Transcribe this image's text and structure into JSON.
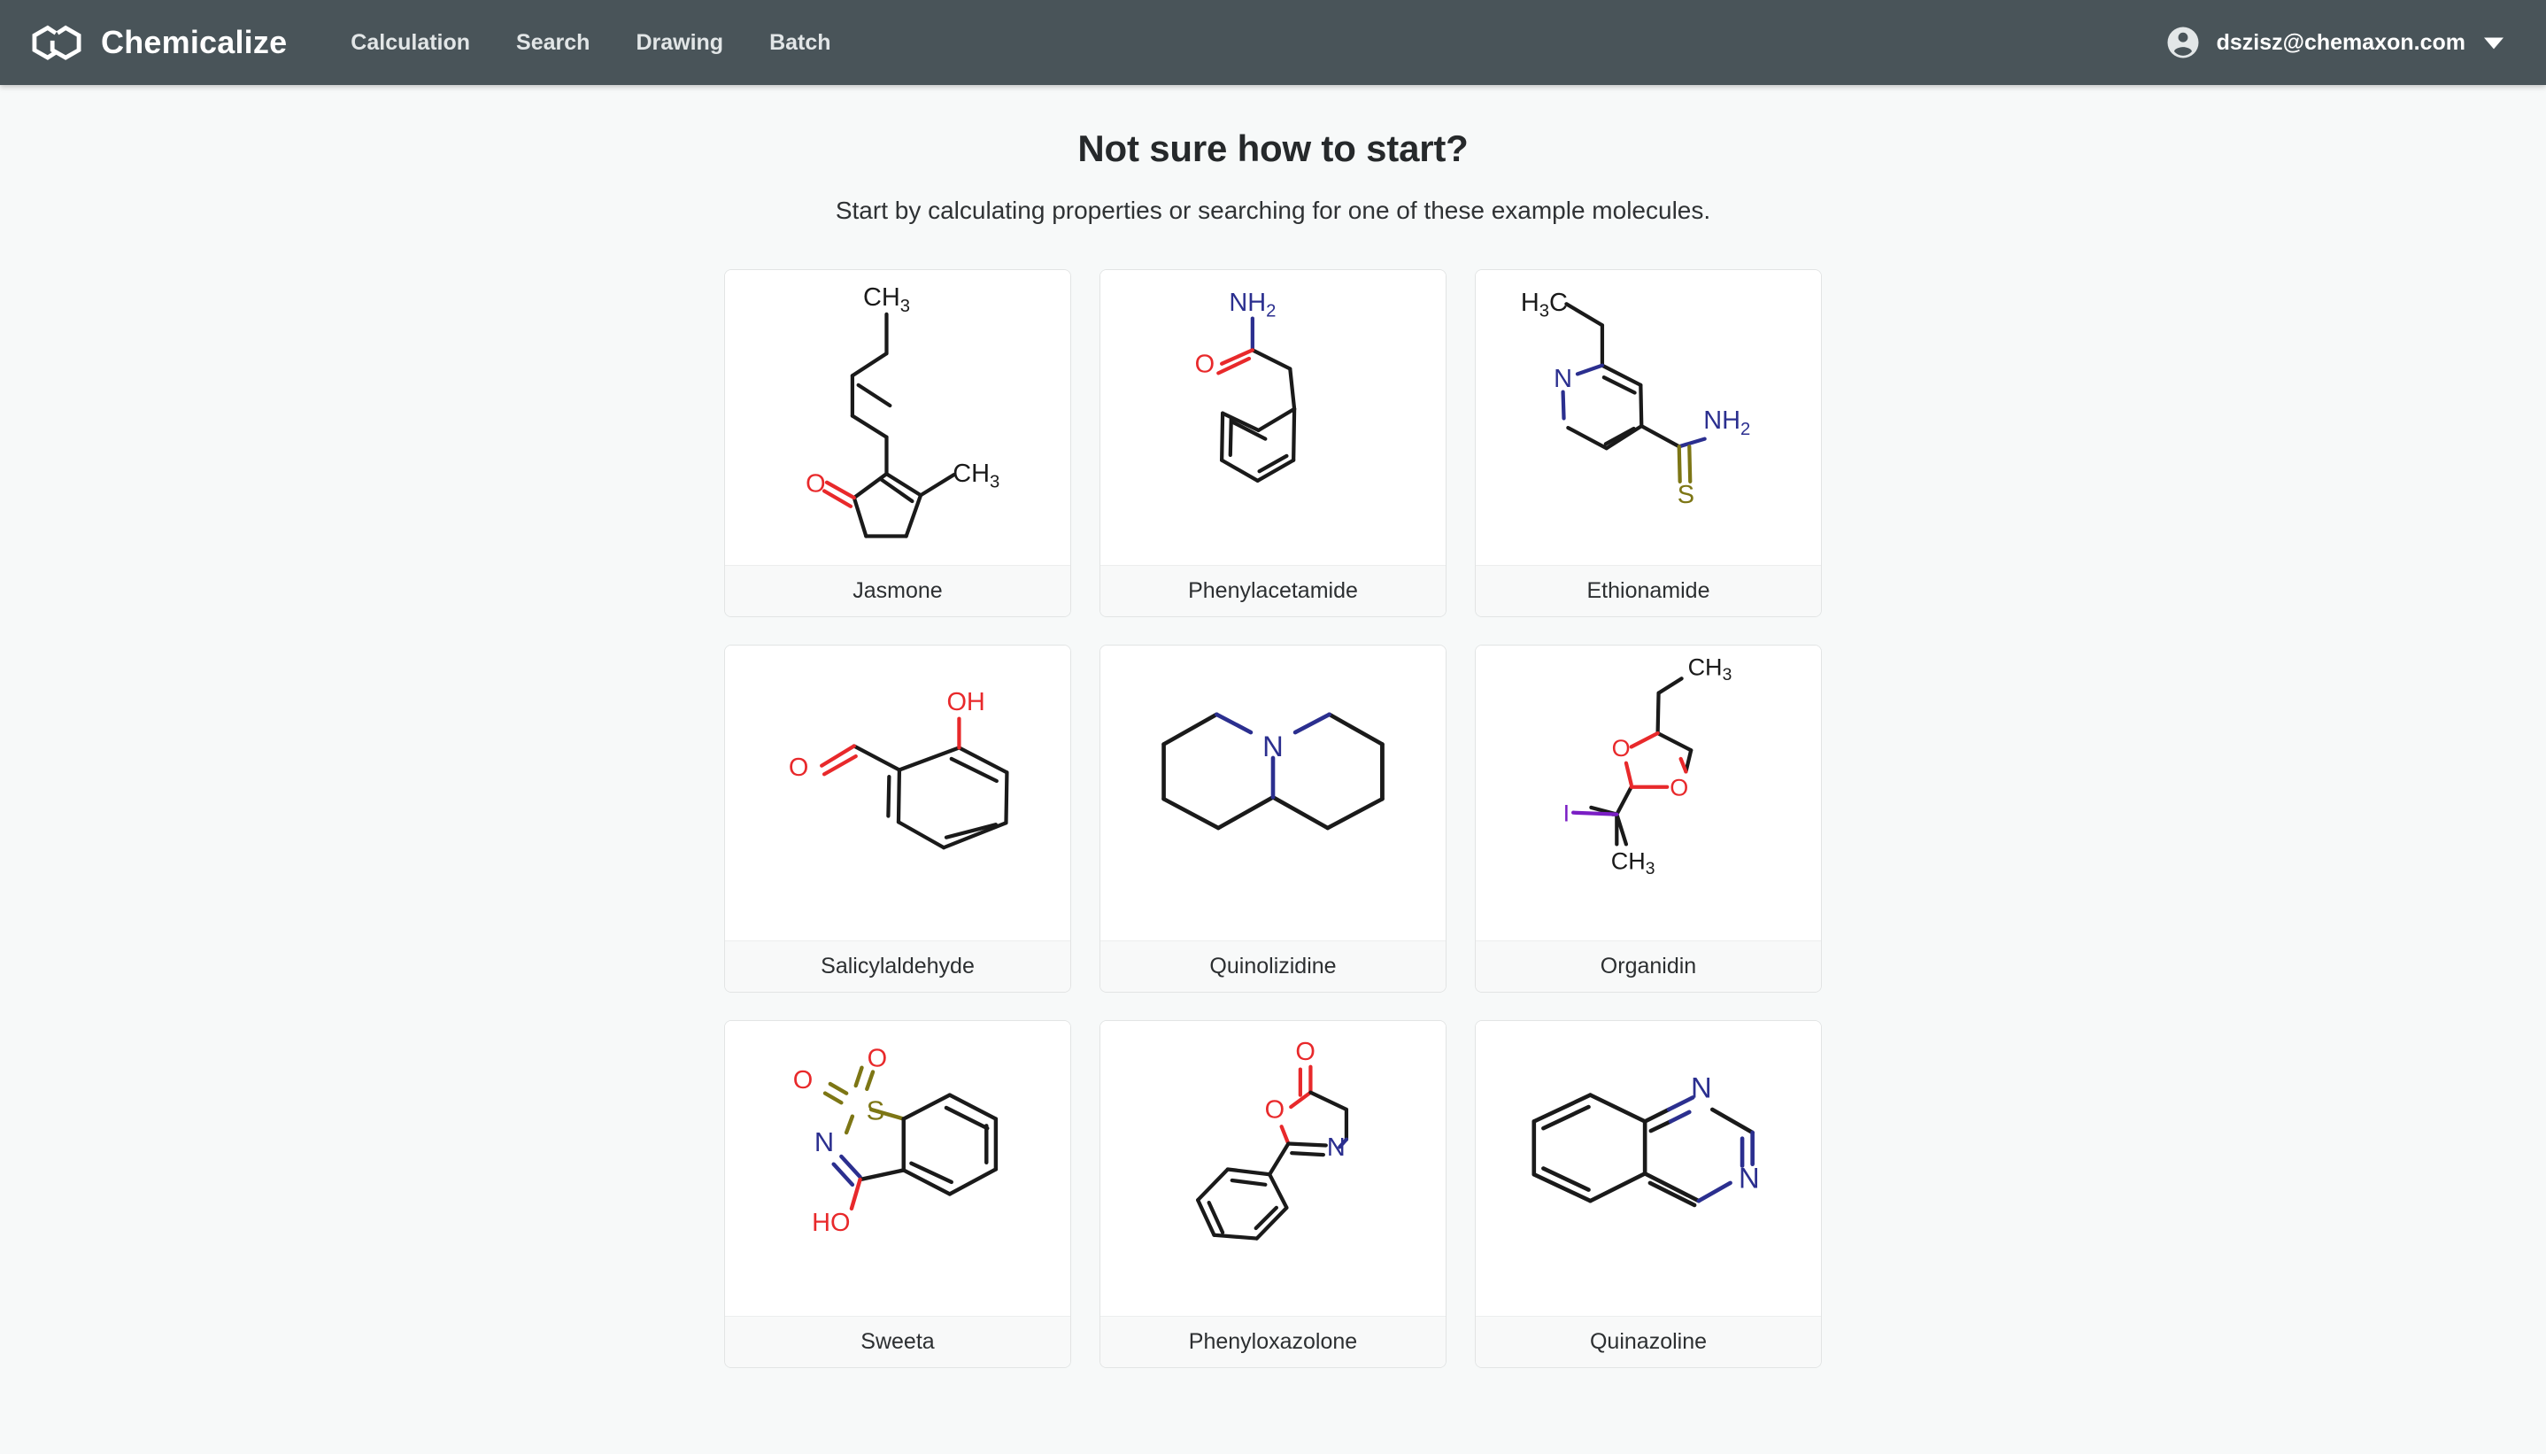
{
  "navbar": {
    "logo_icon": "chemicalize-hexagons-logo",
    "brand": "Chemicalize",
    "links": [
      {
        "label": "Calculation",
        "name": "nav-link-calculation"
      },
      {
        "label": "Search",
        "name": "nav-link-search"
      },
      {
        "label": "Drawing",
        "name": "nav-link-drawing"
      },
      {
        "label": "Batch",
        "name": "nav-link-batch"
      }
    ],
    "account": {
      "avatar_icon": "account-circle-icon",
      "email": "dszisz@chemaxon.com",
      "caret_icon": "chevron-down-icon"
    },
    "colors": {
      "background": "#495459",
      "text": "#ffffff",
      "link": "#e2e6e7"
    }
  },
  "main": {
    "title": "Not sure how to start?",
    "subtitle": "Start by calculating properties or searching for one of these example molecules.",
    "background": "#f7f9f9"
  },
  "molecules": [
    {
      "name": "Jasmone",
      "labels": [
        "CH3",
        "O",
        "CH3"
      ]
    },
    {
      "name": "Phenylacetamide",
      "labels": [
        "NH2",
        "O"
      ]
    },
    {
      "name": "Ethionamide",
      "labels": [
        "H3C",
        "N",
        "NH2",
        "S"
      ]
    },
    {
      "name": "Salicylaldehyde",
      "labels": [
        "OH",
        "O"
      ]
    },
    {
      "name": "Quinolizidine",
      "labels": [
        "N"
      ]
    },
    {
      "name": "Organidin",
      "labels": [
        "CH3",
        "O",
        "O",
        "I",
        "CH3"
      ]
    },
    {
      "name": "Sweeta",
      "labels": [
        "O",
        "O",
        "S",
        "N",
        "HO"
      ]
    },
    {
      "name": "Phenyloxazolone",
      "labels": [
        "O",
        "O",
        "N"
      ]
    },
    {
      "name": "Quinazoline",
      "labels": [
        "N",
        "N"
      ]
    }
  ],
  "atom_colors": {
    "carbon": "#1a1a1a",
    "oxygen": "#e8292b",
    "nitrogen": "#2b2f8f",
    "sulfur": "#7d7615",
    "iodine": "#7a1ec4"
  }
}
